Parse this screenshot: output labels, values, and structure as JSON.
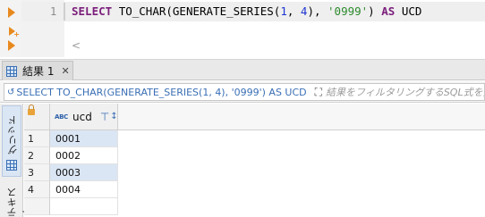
{
  "editor": {
    "line_number": "1",
    "sql": {
      "kw_select": "SELECT",
      "fn_to_char": "TO_CHAR(GENERATE_SERIES(",
      "num_1": "1",
      "comma_sp": ", ",
      "num_4": "4",
      "close1": "), ",
      "fmt": "'0999'",
      "close2": ") ",
      "kw_as": "AS",
      "alias": " UCD"
    },
    "scroll_left": "<"
  },
  "results_tab": {
    "label": "結果 1",
    "close": "✕"
  },
  "filter": {
    "query_text": "SELECT TO_CHAR(GENERATE_SERIES(1, 4), '0999') AS UCD",
    "placeholder": "結果をフィルタリングするSQL式を入力してください"
  },
  "side_tabs": {
    "grid_label": "グリッド",
    "text_label": "テキスト"
  },
  "grid": {
    "column": {
      "type_icon": "ABC",
      "name": "ucd"
    },
    "rows": [
      {
        "num": "1",
        "value": "0001"
      },
      {
        "num": "2",
        "value": "0002"
      },
      {
        "num": "3",
        "value": "0003"
      },
      {
        "num": "4",
        "value": "0004"
      }
    ]
  },
  "colors": {
    "keyword": "#7b1e7b",
    "number": "#1c35d1",
    "string": "#2d8a2d",
    "accent": "#3a6fb5",
    "run_button": "#e8891e",
    "selected_cell": "#dbe6f4"
  }
}
